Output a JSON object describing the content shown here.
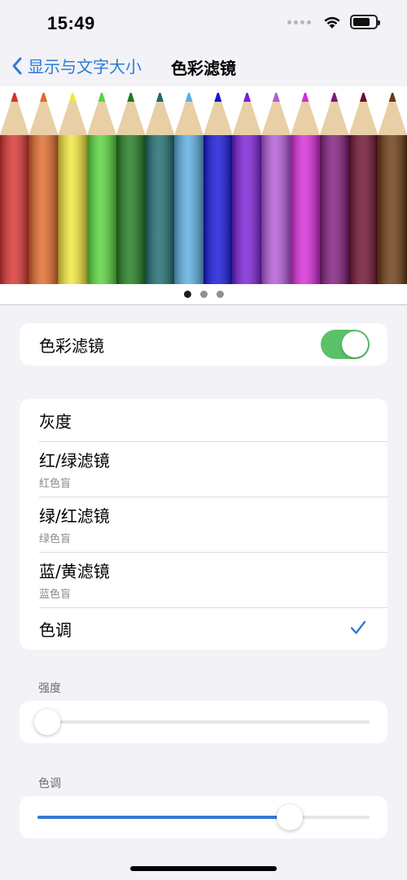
{
  "status": {
    "time": "15:49"
  },
  "nav": {
    "back_label": "显示与文字大小",
    "title": "色彩滤镜"
  },
  "banner": {
    "pencil_colors": [
      "#d8322e",
      "#e06a2a",
      "#f2e83a",
      "#56d43a",
      "#1f7a1e",
      "#1c6b6e",
      "#5aaee0",
      "#1414d8",
      "#7a1ed8",
      "#b45ad8",
      "#d62ad8",
      "#7e1a7a",
      "#6a0e2e",
      "#6b3a12"
    ],
    "pages": 3,
    "active_page": 0
  },
  "filter_toggle": {
    "label": "色彩滤镜",
    "on": true
  },
  "filters": [
    {
      "label": "灰度",
      "sub": "",
      "selected": false
    },
    {
      "label": "红/绿滤镜",
      "sub": "红色盲",
      "selected": false
    },
    {
      "label": "绿/红滤镜",
      "sub": "绿色盲",
      "selected": false
    },
    {
      "label": "蓝/黄滤镜",
      "sub": "蓝色盲",
      "selected": false
    },
    {
      "label": "色调",
      "sub": "",
      "selected": true
    }
  ],
  "intensity": {
    "label": "强度",
    "value": 0.03
  },
  "hue": {
    "label": "色调",
    "value": 0.76
  },
  "colors": {
    "accent": "#3478d4",
    "toggle_on": "#5cc169",
    "background": "#f2f2f7"
  }
}
